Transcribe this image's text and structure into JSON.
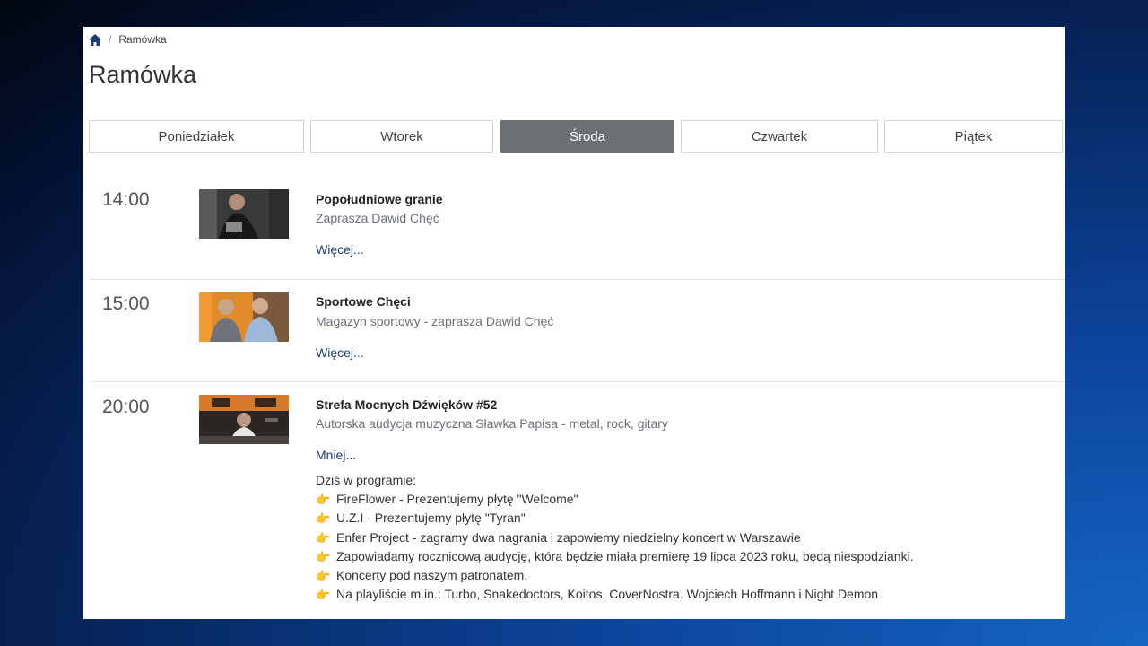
{
  "breadcrumb": {
    "current": "Ramówka"
  },
  "page": {
    "title": "Ramówka"
  },
  "tabs": [
    {
      "label": "Poniedziałek",
      "active": false
    },
    {
      "label": "Wtorek",
      "active": false
    },
    {
      "label": "Środa",
      "active": true
    },
    {
      "label": "Czwartek",
      "active": false
    },
    {
      "label": "Piątek",
      "active": false
    }
  ],
  "shows": [
    {
      "time": "14:00",
      "title": "Popołudniowe granie",
      "description": "Zaprasza Dawid Chęć",
      "toggle": "Więcej..."
    },
    {
      "time": "15:00",
      "title": "Sportowe Chęci",
      "description": "Magazyn sportowy - zaprasza Dawid Chęć",
      "toggle": "Więcej..."
    },
    {
      "time": "20:00",
      "title": "Strefa Mocnych Dźwięków #52",
      "description": "Autorska audycja muzyczna Sławka Papisa - metal, rock, gitary",
      "toggle": "Mniej...",
      "details": {
        "intro": "Dziś w programie:",
        "bullet_icon": "👉",
        "items": [
          "FireFlower - Prezentujemy płytę \"Welcome\"",
          "U.Z.I - Prezentujemy płytę \"Tyran\"",
          "Enfer Project - zagramy dwa nagrania i zapowiemy niedzielny koncert w Warszawie",
          "Zapowiadamy rocznicową audycję, która będzie miała premierę 19 lipca 2023 roku, będą niespodzianki.",
          "Koncerty pod naszym patronatem.",
          "Na playliście m.in.: Turbo, Snakedoctors, Koitos, CoverNostra. Wojciech Hoffmann i Night Demon"
        ]
      }
    }
  ],
  "colors": {
    "active_tab": "#6b7075",
    "link": "#1c3a6e",
    "home_icon": "#1a3a7a"
  }
}
